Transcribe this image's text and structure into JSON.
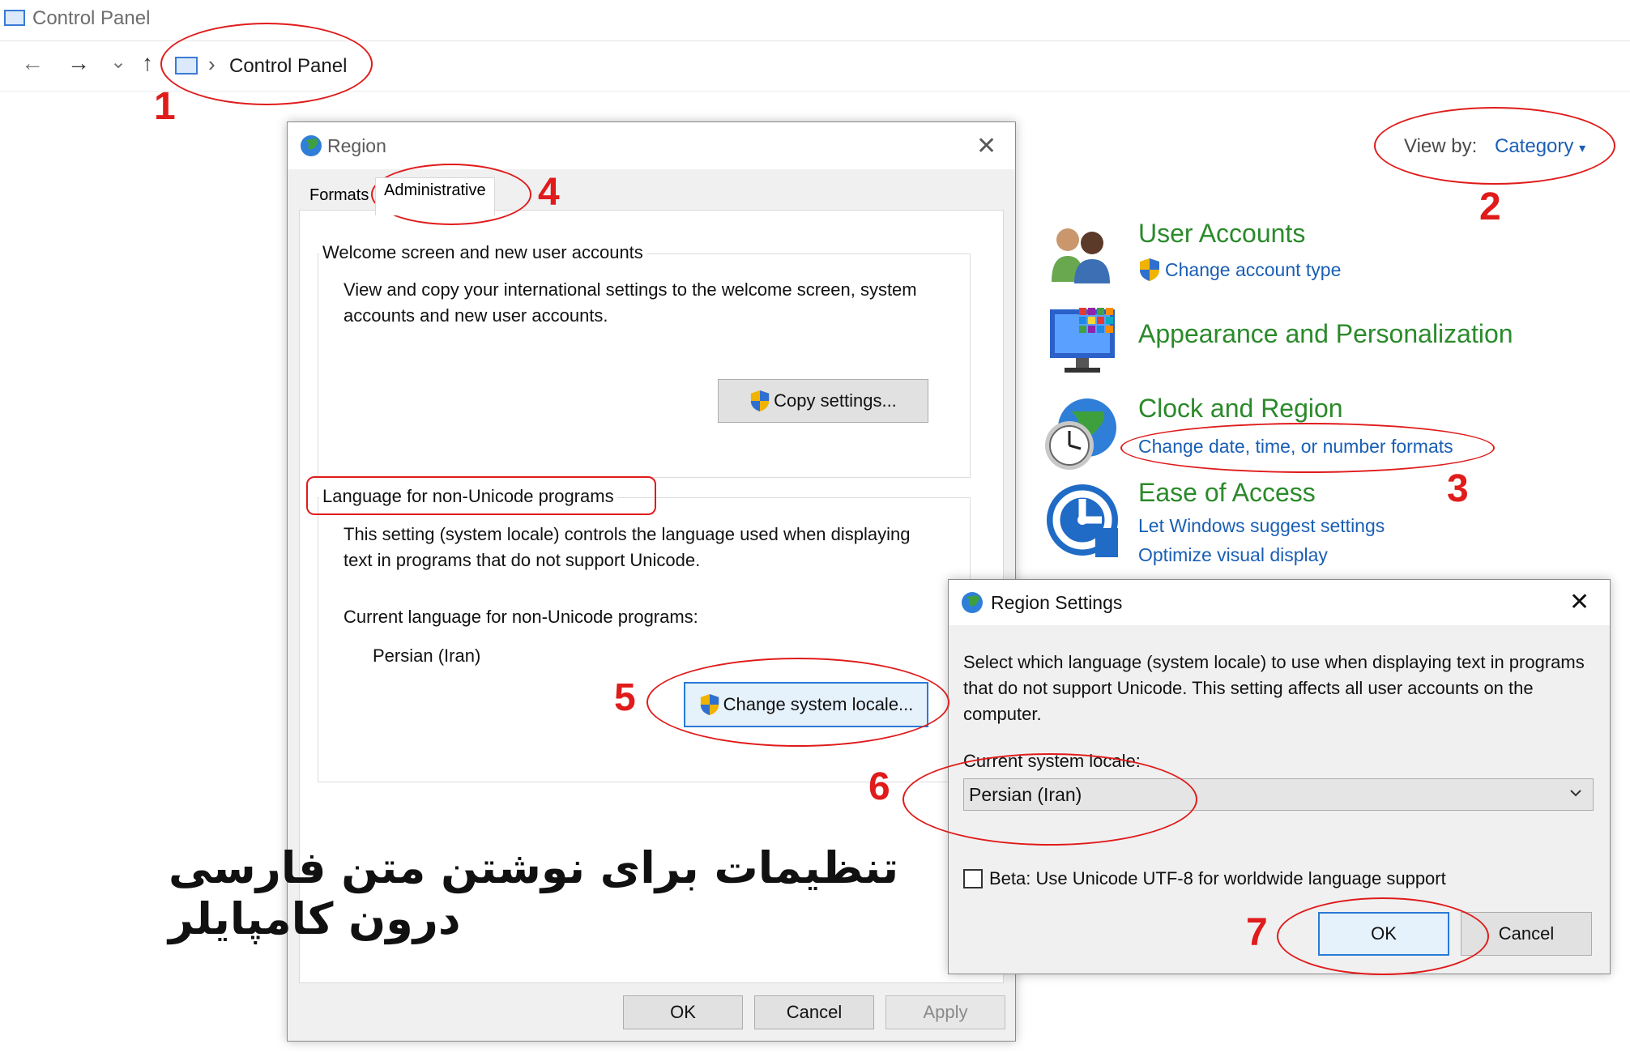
{
  "window": {
    "title": "Control Panel"
  },
  "nav": {
    "back": "←",
    "forward": "→",
    "recent": "⌄",
    "up": "↑",
    "chevron": "›",
    "address": "Control Panel"
  },
  "view_by": {
    "label": "View by:",
    "value": "Category",
    "arrow": "▾"
  },
  "categories": [
    {
      "title": "User Accounts",
      "links": [
        "Change account type"
      ]
    },
    {
      "title": "Appearance and Personalization",
      "links": []
    },
    {
      "title": "Clock and Region",
      "links": [
        "Change date, time, or number formats"
      ]
    },
    {
      "title": "Ease of Access",
      "links": [
        "Let Windows suggest settings",
        "Optimize visual display"
      ]
    }
  ],
  "region_dialog": {
    "title": "Region",
    "close": "✕",
    "tabs": [
      "Formats",
      "Administrative"
    ],
    "welcome_group": {
      "label": "Welcome screen and new user accounts",
      "text": "View and copy your international settings to the welcome screen, system accounts and new user accounts.",
      "button": "Copy settings..."
    },
    "unicode_group": {
      "label": "Language for non-Unicode programs",
      "text": "This setting (system locale) controls the language used when displaying text in programs that do not support Unicode.",
      "current_label": "Current language for non-Unicode programs:",
      "current_value": "Persian (Iran)",
      "button": "Change system locale..."
    },
    "buttons": {
      "ok": "OK",
      "cancel": "Cancel",
      "apply": "Apply"
    }
  },
  "region_settings_dialog": {
    "title": "Region Settings",
    "close": "✕",
    "description": "Select which language (system locale) to use when displaying text in programs that do not support Unicode. This setting affects all user accounts on the computer.",
    "locale_label": "Current system locale:",
    "locale_value": "Persian (Iran)",
    "checkbox_label": "Beta: Use Unicode UTF-8 for worldwide language support",
    "checkbox_checked": false,
    "buttons": {
      "ok": "OK",
      "cancel": "Cancel"
    }
  },
  "annotations": {
    "steps": [
      "1",
      "2",
      "3",
      "4",
      "5",
      "6",
      "7"
    ],
    "caption": "تنظیمات برای نوشتن متن فارسی درون کامپایلر",
    "color": "#e01b1b"
  }
}
